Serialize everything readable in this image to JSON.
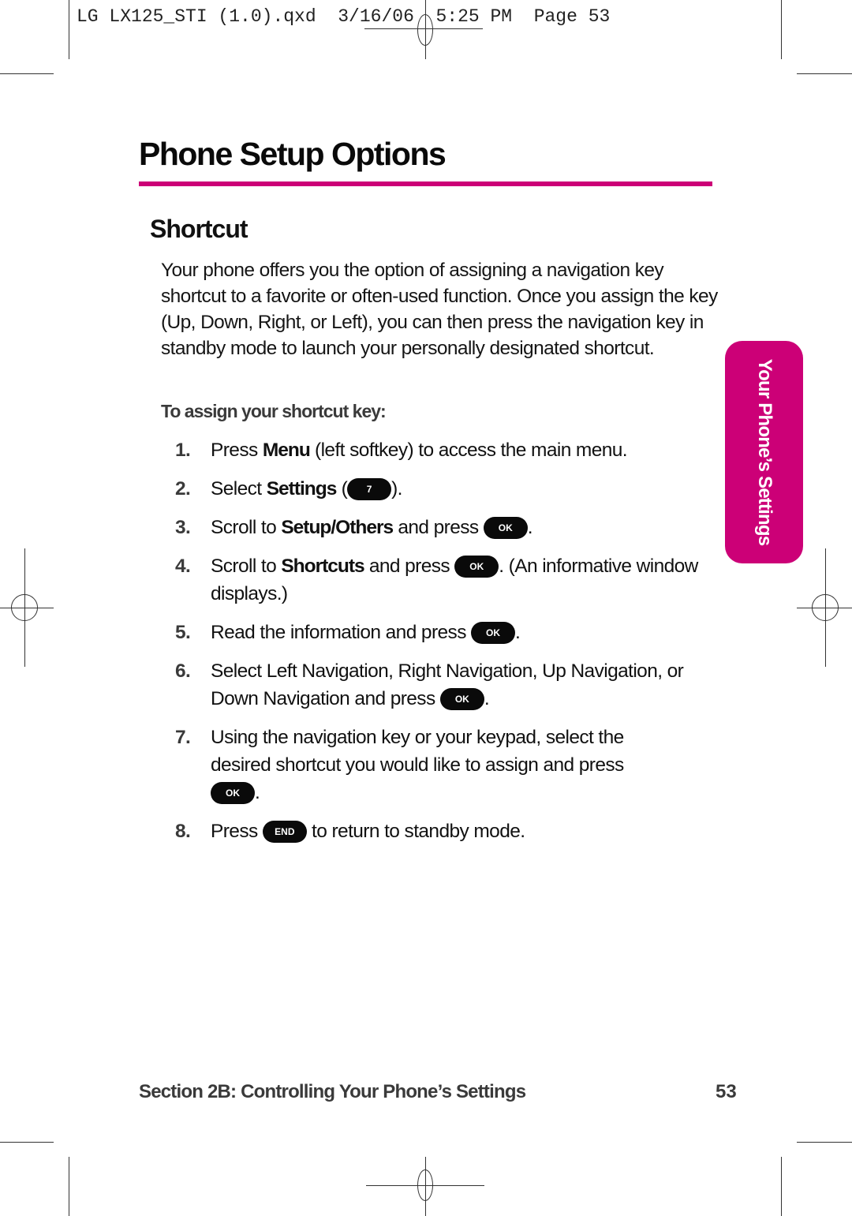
{
  "slug": {
    "text": "LG LX125_STI (1.0).qxd  3/16/06  5:25 PM  Page 53"
  },
  "page": {
    "title": "Phone Setup Options",
    "accent_color": "#cc0077",
    "section_heading": "Shortcut",
    "intro": "Your phone offers you the option of assigning a navigation key shortcut to a favorite or often-used function. Once you assign the key (Up, Down, Right, or Left), you can then press the navigation key in standby mode to launch your personally designated shortcut.",
    "subhead": "To assign your shortcut key:",
    "keys": {
      "ok": "OK",
      "seven": "7",
      "end": "END"
    },
    "steps": [
      {
        "num": "1.",
        "a": "Press ",
        "b": "Menu",
        "c": " (left softkey) to access the main menu."
      },
      {
        "num": "2.",
        "a": "Select ",
        "b": "Settings",
        "c": " (",
        "d": ")."
      },
      {
        "num": "3.",
        "a": "Scroll to ",
        "b": "Setup/Others",
        "c": " and press ",
        "d": "."
      },
      {
        "num": "4.",
        "a": "Scroll to ",
        "b": "Shortcuts",
        "c": " and press ",
        "d": ". (An informative window displays.)"
      },
      {
        "num": "5.",
        "a": "Read the information and press ",
        "d": "."
      },
      {
        "num": "6.",
        "a": "Select Left Navigation, Right Navigation, Up Navigation, or Down Navigation and press ",
        "d": "."
      },
      {
        "num": "7.",
        "a": "Using the navigation key or your keypad, select the desired shortcut you would like to assign and press ",
        "d": "."
      },
      {
        "num": "8.",
        "a": "Press ",
        "d": " to return to standby mode."
      }
    ]
  },
  "side_tab": {
    "label": "Your Phone’s Settings"
  },
  "footer": {
    "section": "Section 2B: Controlling Your Phone’s Settings",
    "page_number": "53"
  }
}
